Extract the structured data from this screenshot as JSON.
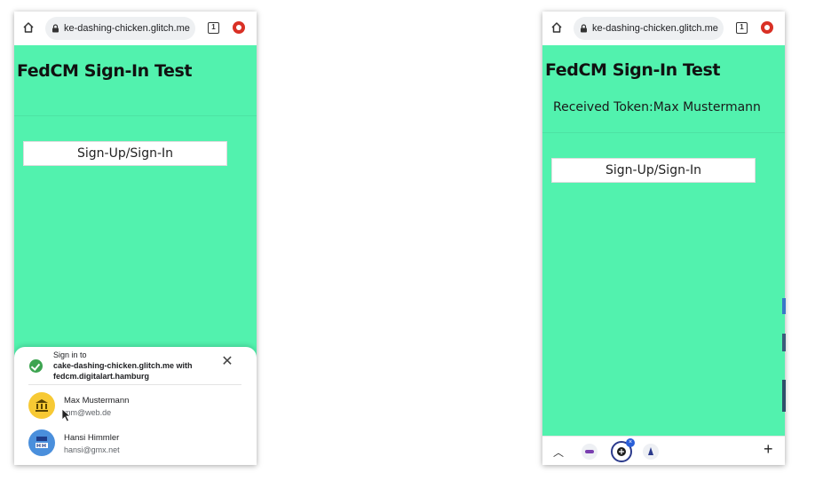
{
  "left_phone": {
    "url": "ke-dashing-chicken.glitch.me",
    "tab_count": "1",
    "title": "FedCM Sign-In Test",
    "button_label": "Sign-Up/Sign-In",
    "sheet": {
      "line1": "Sign in to",
      "line2": "cake-dashing-chicken.glitch.me with",
      "line3": "fedcm.digitalart.hamburg",
      "close_glyph": "✕",
      "accounts": [
        {
          "name": "Max Mustermann",
          "email": "mm@web.de"
        },
        {
          "name": "Hansi Himmler",
          "email": "hansi@gmx.net"
        }
      ]
    }
  },
  "right_phone": {
    "url": "ke-dashing-chicken.glitch.me",
    "tab_count": "1",
    "title": "FedCM Sign-In Test",
    "token_text": "Received Token:Max Mustermann",
    "button_label": "Sign-Up/Sign-In",
    "bottom": {
      "up_glyph": "︿",
      "plus_glyph": "+"
    }
  },
  "colors": {
    "page_bg": "#52f2ae",
    "record": "#d93025",
    "avatar_yellow": "#f7c934",
    "avatar_blue": "#4a8fdc"
  },
  "icons": {
    "home": "home-icon",
    "lock": "lock-icon",
    "tabs": "tab-switcher-icon",
    "record": "record-icon",
    "close": "close-icon",
    "idp": "idp-check-icon",
    "avatar1": "bank-icon",
    "avatar2": "hh-icon",
    "up": "chevron-up-icon",
    "plus": "plus-icon"
  }
}
